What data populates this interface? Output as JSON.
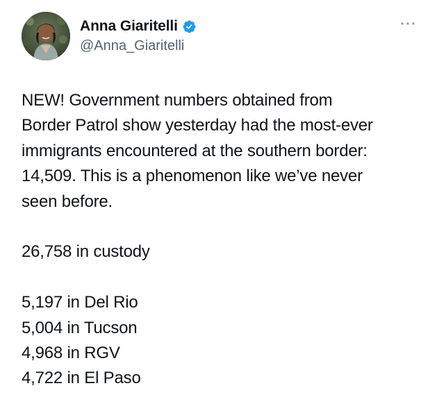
{
  "author": {
    "display_name": "Anna Giaritelli",
    "handle": "@Anna_Giaritelli",
    "verified_icon": "verified-badge-icon",
    "more_icon": "more-dots-icon",
    "verified_color": "#1d9bf0"
  },
  "tweet": {
    "intro_lines": [
      "NEW!  Government numbers obtained from",
      "Border Patrol show yesterday had the most-ever",
      "immigrants encountered at the southern border:",
      "14,509. This is a phenomenon like we’ve never",
      "seen before."
    ],
    "custody": "26,758 in custody",
    "sectors": [
      "5,197 in Del Rio",
      "5,004 in Tucson",
      "4,968 in RGV",
      "4,722 in El Paso"
    ]
  }
}
